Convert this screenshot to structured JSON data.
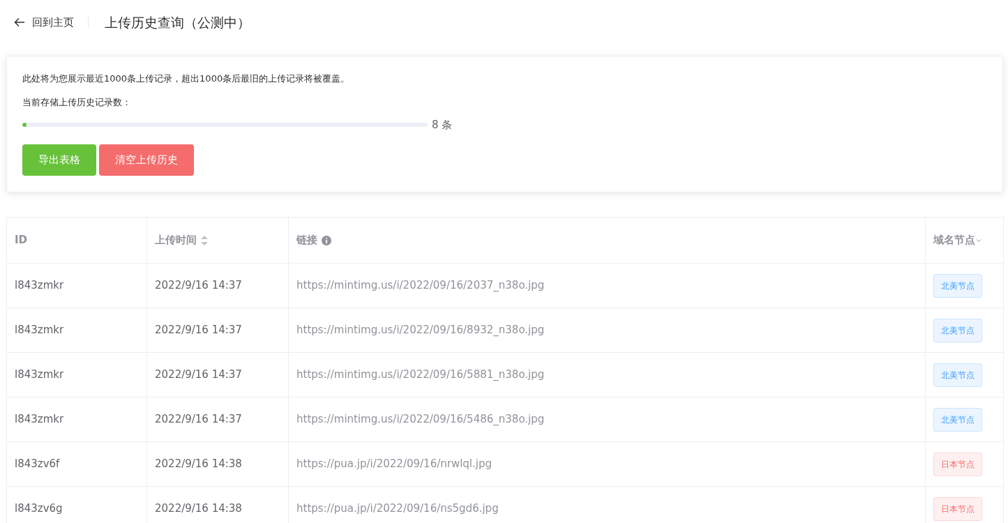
{
  "header": {
    "back_link": "回到主页",
    "title": "上传历史查询（公测中）"
  },
  "summary": {
    "notice": "此处将为您展示最近1000条上传记录，超出1000条后最旧的上传记录将被覆盖。",
    "count_label": "当前存储上传历史记录数：",
    "progress": {
      "level": 0.008,
      "reading": "8 条"
    },
    "buttons": [
      {
        "label": "导出表格",
        "kind": "success"
      },
      {
        "label": "清空上传历史",
        "kind": "danger"
      }
    ]
  },
  "table": {
    "columns": [
      {
        "label": "ID",
        "kind": "plain"
      },
      {
        "label": "上传时间",
        "kind": "sortable"
      },
      {
        "label": "链接",
        "kind": "info"
      },
      {
        "label": "域名节点",
        "kind": "filter"
      }
    ],
    "rows": [
      {
        "id": "l843zmkr",
        "time": "2022/9/16 14:37",
        "link": "https://mintimg.us/i/2022/09/16/2037_n38o.jpg",
        "node": {
          "label": "北美节点",
          "color": "#409eff"
        }
      },
      {
        "id": "l843zmkr",
        "time": "2022/9/16 14:37",
        "link": "https://mintimg.us/i/2022/09/16/8932_n38o.jpg",
        "node": {
          "label": "北美节点",
          "color": "#409eff"
        }
      },
      {
        "id": "l843zmkr",
        "time": "2022/9/16 14:37",
        "link": "https://mintimg.us/i/2022/09/16/5881_n38o.jpg",
        "node": {
          "label": "北美节点",
          "color": "#409eff"
        }
      },
      {
        "id": "l843zmkr",
        "time": "2022/9/16 14:37",
        "link": "https://mintimg.us/i/2022/09/16/5486_n38o.jpg",
        "node": {
          "label": "北美节点",
          "color": "#409eff"
        }
      },
      {
        "id": "l843zv6f",
        "time": "2022/9/16 14:38",
        "link": "https://pua.jp/i/2022/09/16/nrwlql.jpg",
        "node": {
          "label": "日本节点",
          "color": "#f56c6c"
        }
      },
      {
        "id": "l843zv6g",
        "time": "2022/9/16 14:38",
        "link": "https://pua.jp/i/2022/09/16/ns5gd6.jpg",
        "node": {
          "label": "日本节点",
          "color": "#f56c6c"
        }
      }
    ]
  }
}
